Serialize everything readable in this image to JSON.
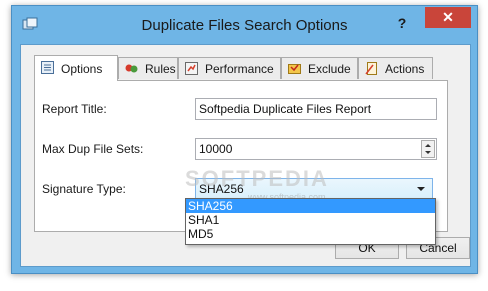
{
  "window": {
    "title": "Duplicate Files Search Options",
    "help_label": "?",
    "close_label": "✕"
  },
  "tabs": [
    {
      "label": "Options",
      "icon": "options-icon",
      "active": true
    },
    {
      "label": "Rules",
      "icon": "rules-icon"
    },
    {
      "label": "Performance",
      "icon": "performance-icon"
    },
    {
      "label": "Exclude",
      "icon": "exclude-icon"
    },
    {
      "label": "Actions",
      "icon": "actions-icon"
    }
  ],
  "form": {
    "report_title_label": "Report Title:",
    "report_title_value": "Softpedia Duplicate Files Report",
    "max_dup_label": "Max Dup File Sets:",
    "max_dup_value": "10000",
    "signature_label": "Signature Type:",
    "signature_value": "SHA256",
    "signature_options": [
      "SHA256",
      "SHA1",
      "MD5"
    ]
  },
  "buttons": {
    "ok_label": "OK",
    "cancel_label": "Cancel"
  },
  "watermark": {
    "text": "SOFTPEDIA",
    "sub": "www.softpedia.com"
  },
  "colors": {
    "titlebar": "#6fb5e6",
    "close_button": "#c9453a",
    "selection": "#3399ff"
  }
}
